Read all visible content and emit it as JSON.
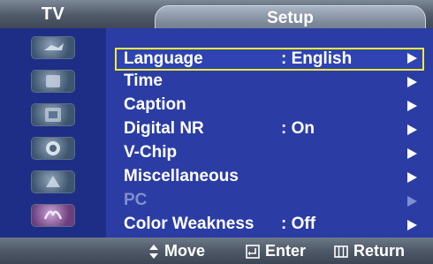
{
  "header": {
    "source_label": "TV",
    "menu_title": "Setup"
  },
  "rail": {
    "icons": [
      "picture-icon",
      "sound-icon",
      "channel-icon",
      "setup-icon",
      "input-icon",
      "application-icon"
    ]
  },
  "menu": {
    "items": [
      {
        "label": "Language",
        "value": ": English",
        "selected": true,
        "enabled": true
      },
      {
        "label": "Time",
        "value": "",
        "selected": false,
        "enabled": true
      },
      {
        "label": "Caption",
        "value": "",
        "selected": false,
        "enabled": true
      },
      {
        "label": "Digital NR",
        "value": ": On",
        "selected": false,
        "enabled": true
      },
      {
        "label": "V-Chip",
        "value": "",
        "selected": false,
        "enabled": true
      },
      {
        "label": "Miscellaneous",
        "value": "",
        "selected": false,
        "enabled": true
      },
      {
        "label": "PC",
        "value": "",
        "selected": false,
        "enabled": false
      },
      {
        "label": "Color Weakness",
        "value": ": Off",
        "selected": false,
        "enabled": true
      }
    ]
  },
  "footer": {
    "move_label": "Move",
    "enter_label": "Enter",
    "return_label": "Return"
  },
  "colors": {
    "panel": "#2b3da4",
    "selection": "#f2e93d",
    "disabled_text": "#7f8fd0"
  }
}
